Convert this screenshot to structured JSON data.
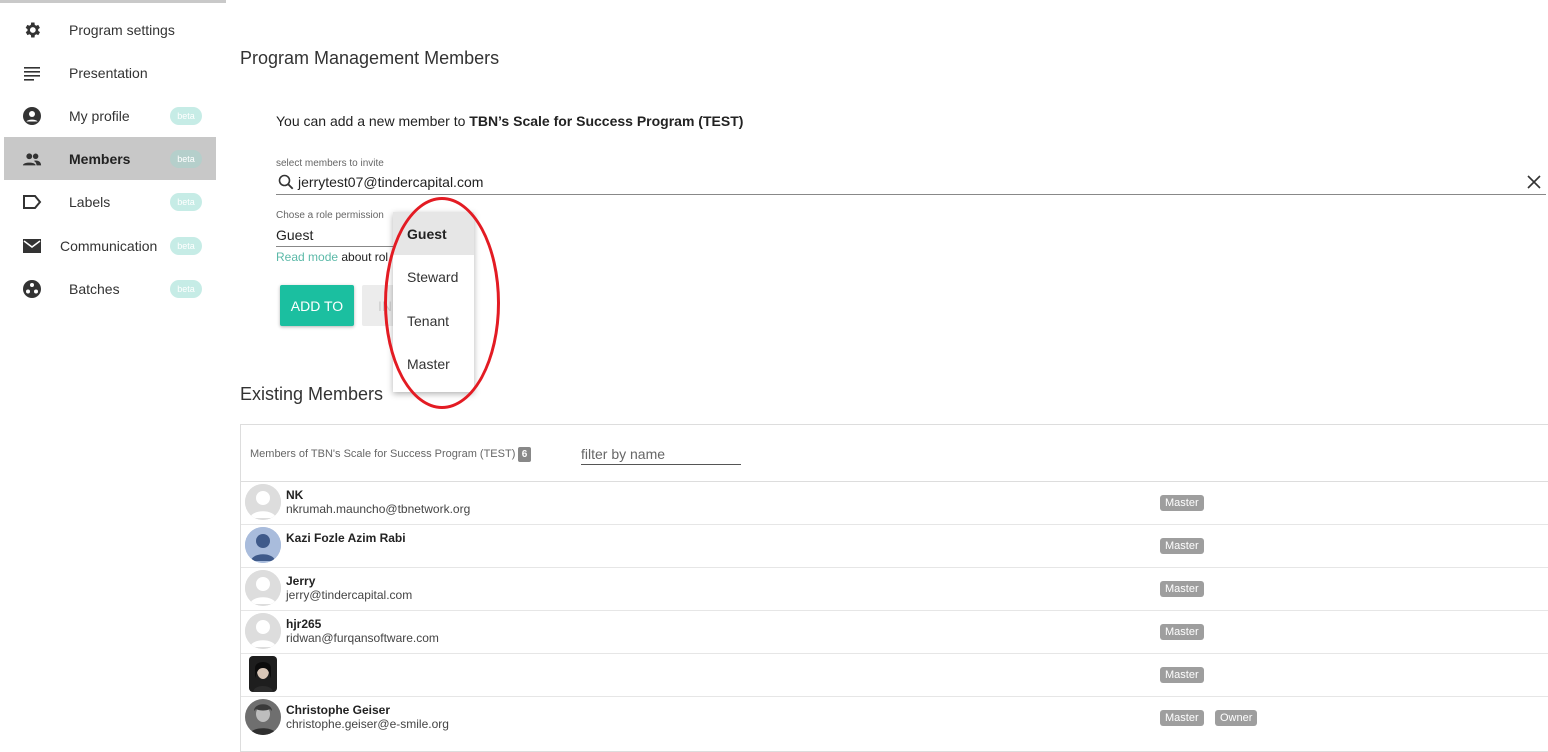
{
  "sidebar": {
    "items": [
      {
        "label": "Program settings",
        "icon": "gear-icon",
        "beta": ""
      },
      {
        "label": "Presentation",
        "icon": "lines-icon",
        "beta": ""
      },
      {
        "label": "My profile",
        "icon": "account-circle-icon",
        "beta": "beta"
      },
      {
        "label": "Members",
        "icon": "people-icon",
        "beta": "beta",
        "active": true
      },
      {
        "label": "Labels",
        "icon": "label-icon",
        "beta": "beta"
      },
      {
        "label": "Communication",
        "icon": "mail-icon",
        "beta": "beta"
      },
      {
        "label": "Batches",
        "icon": "batches-icon",
        "beta": "beta"
      }
    ]
  },
  "main": {
    "title": "Program Management Members",
    "intro_prefix": "You can add a new member to ",
    "intro_program": "TBN’s Scale for Success Program (TEST)",
    "invite_label": "select members to invite",
    "invite_value": "jerrytest07@tindercapital.com",
    "role_label": "Chose a role permission",
    "role_value": "Guest",
    "hint_link": "Read mode",
    "hint_text": " about rol",
    "add_button": "ADD TO",
    "ghost_button": "IN",
    "role_options": [
      "Guest",
      "Steward",
      "Tenant",
      "Master"
    ],
    "selected_option": "Guest"
  },
  "existing": {
    "title": "Existing Members",
    "list_label": "Members of TBN's Scale for Success Program (TEST)",
    "count": "6",
    "filter_placeholder": "filter by name",
    "members": [
      {
        "name": "NK",
        "email": "nkrumah.mauncho@tbnetwork.org",
        "roles": [
          "Master"
        ],
        "avatar": "default"
      },
      {
        "name": "Kazi Fozle Azim Rabi",
        "email": "",
        "roles": [
          "Master"
        ],
        "avatar": "blue-person"
      },
      {
        "name": "Jerry",
        "email": "jerry@tindercapital.com",
        "roles": [
          "Master"
        ],
        "avatar": "default"
      },
      {
        "name": "hjr265",
        "email": "ridwan@furqansoftware.com",
        "roles": [
          "Master"
        ],
        "avatar": "default"
      },
      {
        "name": "",
        "email": "",
        "roles": [
          "Master"
        ],
        "avatar": "photo-dark"
      },
      {
        "name": "Christophe Geiser",
        "email": "christophe.geiser@e-smile.org",
        "roles": [
          "Master",
          "Owner"
        ],
        "avatar": "photo-gray"
      }
    ]
  },
  "colors": {
    "accent": "#1bbfa0",
    "link": "#5bb9a8",
    "beta_badge": "#c6ece6",
    "role_badge": "#9e9e9e",
    "annotation": "#e31b23"
  }
}
